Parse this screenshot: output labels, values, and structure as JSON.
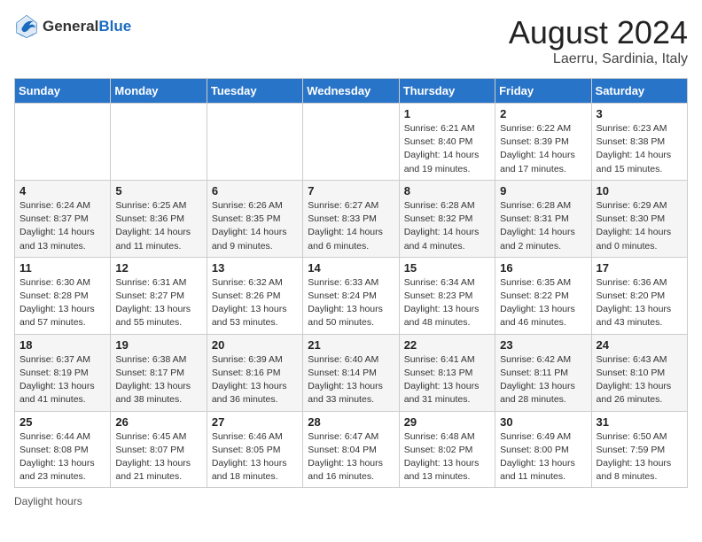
{
  "header": {
    "logo_general": "General",
    "logo_blue": "Blue",
    "month_year": "August 2024",
    "location": "Laerru, Sardinia, Italy"
  },
  "days_of_week": [
    "Sunday",
    "Monday",
    "Tuesday",
    "Wednesday",
    "Thursday",
    "Friday",
    "Saturday"
  ],
  "weeks": [
    [
      {
        "day": "",
        "detail": ""
      },
      {
        "day": "",
        "detail": ""
      },
      {
        "day": "",
        "detail": ""
      },
      {
        "day": "",
        "detail": ""
      },
      {
        "day": "1",
        "detail": "Sunrise: 6:21 AM\nSunset: 8:40 PM\nDaylight: 14 hours\nand 19 minutes."
      },
      {
        "day": "2",
        "detail": "Sunrise: 6:22 AM\nSunset: 8:39 PM\nDaylight: 14 hours\nand 17 minutes."
      },
      {
        "day": "3",
        "detail": "Sunrise: 6:23 AM\nSunset: 8:38 PM\nDaylight: 14 hours\nand 15 minutes."
      }
    ],
    [
      {
        "day": "4",
        "detail": "Sunrise: 6:24 AM\nSunset: 8:37 PM\nDaylight: 14 hours\nand 13 minutes."
      },
      {
        "day": "5",
        "detail": "Sunrise: 6:25 AM\nSunset: 8:36 PM\nDaylight: 14 hours\nand 11 minutes."
      },
      {
        "day": "6",
        "detail": "Sunrise: 6:26 AM\nSunset: 8:35 PM\nDaylight: 14 hours\nand 9 minutes."
      },
      {
        "day": "7",
        "detail": "Sunrise: 6:27 AM\nSunset: 8:33 PM\nDaylight: 14 hours\nand 6 minutes."
      },
      {
        "day": "8",
        "detail": "Sunrise: 6:28 AM\nSunset: 8:32 PM\nDaylight: 14 hours\nand 4 minutes."
      },
      {
        "day": "9",
        "detail": "Sunrise: 6:28 AM\nSunset: 8:31 PM\nDaylight: 14 hours\nand 2 minutes."
      },
      {
        "day": "10",
        "detail": "Sunrise: 6:29 AM\nSunset: 8:30 PM\nDaylight: 14 hours\nand 0 minutes."
      }
    ],
    [
      {
        "day": "11",
        "detail": "Sunrise: 6:30 AM\nSunset: 8:28 PM\nDaylight: 13 hours\nand 57 minutes."
      },
      {
        "day": "12",
        "detail": "Sunrise: 6:31 AM\nSunset: 8:27 PM\nDaylight: 13 hours\nand 55 minutes."
      },
      {
        "day": "13",
        "detail": "Sunrise: 6:32 AM\nSunset: 8:26 PM\nDaylight: 13 hours\nand 53 minutes."
      },
      {
        "day": "14",
        "detail": "Sunrise: 6:33 AM\nSunset: 8:24 PM\nDaylight: 13 hours\nand 50 minutes."
      },
      {
        "day": "15",
        "detail": "Sunrise: 6:34 AM\nSunset: 8:23 PM\nDaylight: 13 hours\nand 48 minutes."
      },
      {
        "day": "16",
        "detail": "Sunrise: 6:35 AM\nSunset: 8:22 PM\nDaylight: 13 hours\nand 46 minutes."
      },
      {
        "day": "17",
        "detail": "Sunrise: 6:36 AM\nSunset: 8:20 PM\nDaylight: 13 hours\nand 43 minutes."
      }
    ],
    [
      {
        "day": "18",
        "detail": "Sunrise: 6:37 AM\nSunset: 8:19 PM\nDaylight: 13 hours\nand 41 minutes."
      },
      {
        "day": "19",
        "detail": "Sunrise: 6:38 AM\nSunset: 8:17 PM\nDaylight: 13 hours\nand 38 minutes."
      },
      {
        "day": "20",
        "detail": "Sunrise: 6:39 AM\nSunset: 8:16 PM\nDaylight: 13 hours\nand 36 minutes."
      },
      {
        "day": "21",
        "detail": "Sunrise: 6:40 AM\nSunset: 8:14 PM\nDaylight: 13 hours\nand 33 minutes."
      },
      {
        "day": "22",
        "detail": "Sunrise: 6:41 AM\nSunset: 8:13 PM\nDaylight: 13 hours\nand 31 minutes."
      },
      {
        "day": "23",
        "detail": "Sunrise: 6:42 AM\nSunset: 8:11 PM\nDaylight: 13 hours\nand 28 minutes."
      },
      {
        "day": "24",
        "detail": "Sunrise: 6:43 AM\nSunset: 8:10 PM\nDaylight: 13 hours\nand 26 minutes."
      }
    ],
    [
      {
        "day": "25",
        "detail": "Sunrise: 6:44 AM\nSunset: 8:08 PM\nDaylight: 13 hours\nand 23 minutes."
      },
      {
        "day": "26",
        "detail": "Sunrise: 6:45 AM\nSunset: 8:07 PM\nDaylight: 13 hours\nand 21 minutes."
      },
      {
        "day": "27",
        "detail": "Sunrise: 6:46 AM\nSunset: 8:05 PM\nDaylight: 13 hours\nand 18 minutes."
      },
      {
        "day": "28",
        "detail": "Sunrise: 6:47 AM\nSunset: 8:04 PM\nDaylight: 13 hours\nand 16 minutes."
      },
      {
        "day": "29",
        "detail": "Sunrise: 6:48 AM\nSunset: 8:02 PM\nDaylight: 13 hours\nand 13 minutes."
      },
      {
        "day": "30",
        "detail": "Sunrise: 6:49 AM\nSunset: 8:00 PM\nDaylight: 13 hours\nand 11 minutes."
      },
      {
        "day": "31",
        "detail": "Sunrise: 6:50 AM\nSunset: 7:59 PM\nDaylight: 13 hours\nand 8 minutes."
      }
    ]
  ],
  "footer": {
    "daylight_label": "Daylight hours"
  }
}
